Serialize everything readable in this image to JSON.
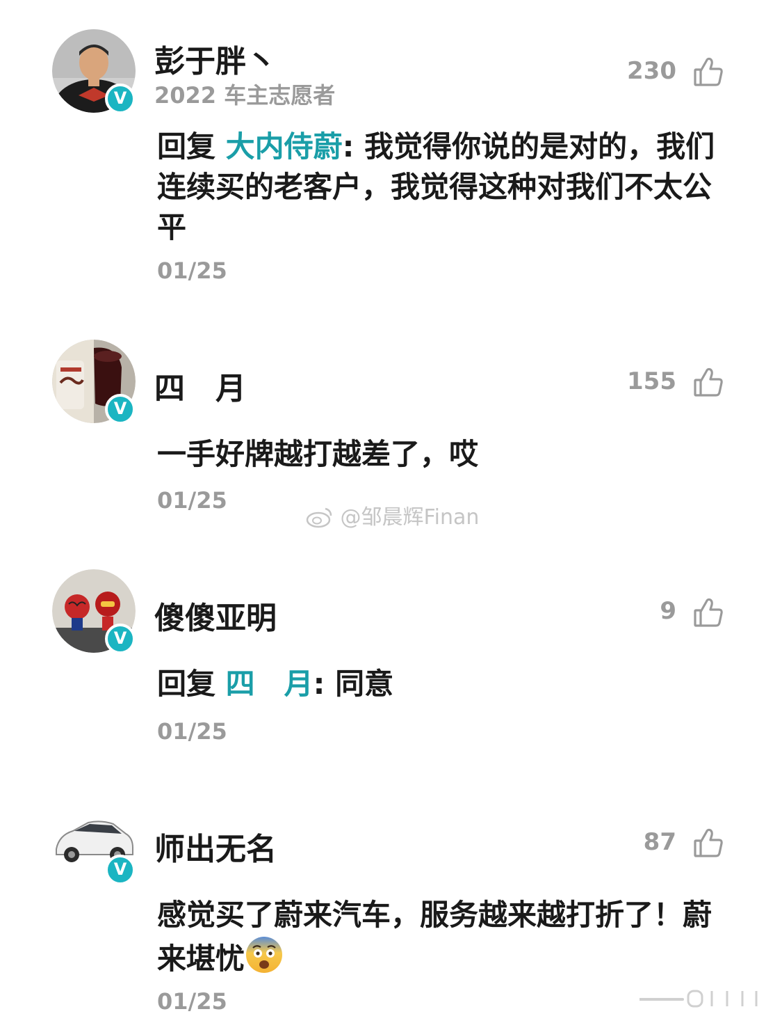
{
  "comments": [
    {
      "username": "彭于胖丶",
      "subtitle": "2022 车主志愿者",
      "likes": "230",
      "reply_prefix": "回复 ",
      "mention": "大内侍蔚",
      "reply_sep": ": ",
      "text": "我觉得你说的是对的，我们连续买的老客户，我觉得这种对我们不太公平",
      "date": "01/25",
      "badge": "V"
    },
    {
      "username": "四　月",
      "likes": "155",
      "text": "一手好牌越打越差了，哎",
      "date": "01/25",
      "badge": "V"
    },
    {
      "username": "傻傻亚明",
      "likes": "9",
      "reply_prefix": "回复 ",
      "mention": "四　月",
      "reply_sep": ": ",
      "text": "同意",
      "date": "01/25",
      "badge": "V"
    },
    {
      "username": "师出无名",
      "likes": "87",
      "text": "感觉买了蔚来汽车，服务越来越打折了！蔚来堪忧",
      "date": "01/25",
      "badge": "V"
    }
  ],
  "watermark": "@邹晨辉Finan",
  "colors": {
    "accent": "#1bb5c2",
    "mention": "#1a9ea8",
    "muted": "#9a9a9a",
    "text": "#1a1a1a"
  },
  "icons": {
    "like": "thumbs-up-icon",
    "verified": "verified-badge-icon",
    "emoji": "fearful-face-emoji"
  }
}
